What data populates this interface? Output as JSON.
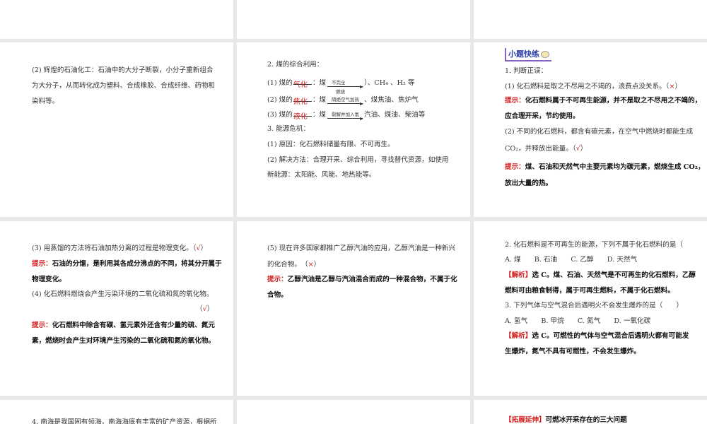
{
  "slides": {
    "r2c1": {
      "l1": "(2) 辉煌的石油化工：石油中的大分子断裂，小分子重新组合",
      "l2": "为大分子，从而转化成为塑料、合成橡胶、合成纤维、药物和",
      "l3": "染料等。"
    },
    "r2c2": {
      "title": "2. 煤的综合利用：",
      "i1_pre": "(1) 煤的",
      "i1_ans": "气化",
      "i1_mid": "：煤",
      "i1_up": "不完全",
      "i1_dn": "燃烧",
      "i1_post": "）、CH₄ 、H₂ 等",
      "i2_pre": "(2) 煤的",
      "i2_ans": "焦化",
      "i2_mid": "：煤",
      "i2_up": "隔绝空气加热",
      "i2_post": "、煤焦油、焦炉气",
      "i3_pre": "(3) 煤的",
      "i3_ans": "液化",
      "i3_mid": "：煤",
      "i3_up": "裂解并加入氢",
      "i3_post": "汽油、煤油、柴油等",
      "s3": "3. 能源危机：",
      "s3_1": "(1) 原因：化石燃料储量有限、不可再生。",
      "s3_2a": "(2) 解决方法：合理开采、综合利用，寻找替代资源，如使用",
      "s3_2b": "新能源：太阳能、风能、地热能等。"
    },
    "r2c3": {
      "header": "小题快练",
      "q1": "1. 判断正误：",
      "q1_1": "(1) 化石燃料是取之不尽用之不竭的，浪费点没关系。（",
      "q1_1_mark": "×",
      "close": "）",
      "hint_label": "提示：",
      "h1a": "化石燃料属于不可再生能源，并不是取之不尽用之不竭的，",
      "h1b": "应合理开采，节约使用。",
      "q1_2a": "(2) 不同的化石燃料，都含有碳元素，在空气中燃烧时都能生成",
      "q1_2b": "CO₂，并释放出能量。（",
      "q1_2_mark": "√",
      "h2a": "煤、石油和天然气中主要元素均为碳元素，燃烧生成 CO₂，",
      "h2b": "放出大量的热。"
    },
    "r3c1": {
      "q3": "(3) 用蒸馏的方法将石油加热分离的过程是物理变化。（",
      "q3_mark": "√",
      "h3a": "石油的分馏，是利用其各成分沸点的不同，将其分开属于",
      "h3b": "物理变化。",
      "q4": "(4) 化石燃料燃烧会产生污染环境的二氧化硫和氮的氧化物。",
      "q4_open": "（",
      "q4_mark": "√",
      "h4a": "化石燃料中除含有碳、氢元素外还含有少量的硫、氮元",
      "h4b": "素，燃烧时会产生对环境产生污染的二氧化硫和氮的氧化物。"
    },
    "r3c2": {
      "q5a": "(5) 现在许多国家都推广乙醇汽油的应用，乙醇汽油是一种新兴",
      "q5b": "的化合物。　（",
      "q5_mark": "×",
      "h5a": "乙醇汽油是乙醇与汽油混合而成的一种混合物，不属于化",
      "h5b": "合物。"
    },
    "r3c3": {
      "q2": "2. 化石燃料是不可再生的能源，下列不属于化石燃料的是（",
      "q2_opts": "A. 煤　　B. 石油　　C. 乙醇　　D. 天然气",
      "jx_label": "【解析】",
      "a2a": "选 C。煤、石油、天然气是不可再生的化石燃料，乙醇",
      "a2b": "燃料可由粮食制得，属于可再生燃料，不属于化石燃料。",
      "q3": "3. 下列气体与空气混合后遇明火不会发生爆炸的是（　　）",
      "q3_opts": "A. 氢气　　B. 甲烷　　C. 氮气　　D. 一氧化碳",
      "a3a": "选 C。可燃性的气体与空气混合后遇明火都有可能发",
      "a3b": "生爆炸，氮气不具有可燃性，不会发生爆炸。"
    },
    "r4c1": {
      "l1": "4. 南海是我国固有领海，南海海底有丰富的矿产资源，根据所"
    },
    "r4c3": {
      "label": "【拓展延伸】",
      "l1": "可燃冰开采存在的三大问题"
    }
  }
}
